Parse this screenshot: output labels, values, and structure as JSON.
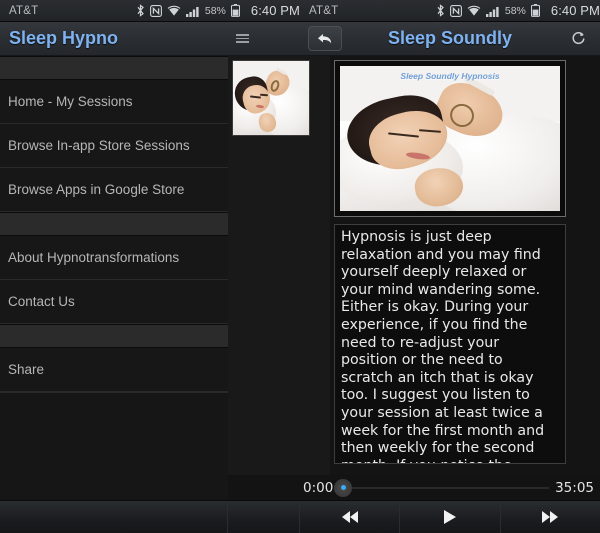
{
  "status_bar_left": {
    "carrier": "AT&T",
    "battery_pct": "58%",
    "clock": "6:40 PM",
    "icons": [
      "bluetooth-icon",
      "nfc-icon",
      "wifi-icon",
      "cell-signal-icon",
      "battery-icon"
    ]
  },
  "status_bar_right": {
    "carrier": "AT&T",
    "battery_pct": "58%",
    "clock": "6:40 PM",
    "icons": [
      "bluetooth-icon",
      "nfc-icon",
      "wifi-icon",
      "cell-signal-icon",
      "battery-icon"
    ]
  },
  "left_app": {
    "title": "Sleep Hypno",
    "menu_icon": "hamburger-menu-icon"
  },
  "right_app": {
    "title": "Sleep Soundly",
    "back_icon": "back-arrow-icon",
    "refresh_icon": "refresh-icon"
  },
  "drawer": {
    "items": [
      {
        "label": "Home - My Sessions"
      },
      {
        "label": "Browse In-app Store Sessions"
      },
      {
        "label": "Browse Apps in Google Store"
      },
      {
        "label": "About Hypnotransformations"
      },
      {
        "label": "Contact Us"
      },
      {
        "label": "Share"
      }
    ]
  },
  "thumbnail": {
    "name": "session-thumbnail",
    "alt": "Woman sleeping on white pillow"
  },
  "content": {
    "hero_caption": "Sleep Soundly Hypnosis",
    "hero_alt": "Woman sleeping peacefully under a white duvet",
    "body": "Hypnosis is just deep relaxation and you may find yourself deeply relaxed or your mind wandering some. Either is okay. During your experience, if you find the need to re-adjust your position or the need to scratch an itch that is okay too. I suggest you listen to your session at least twice a week for the first month and then weekly for the second month. If you notice the suggestions starting to \"wear off\" just start the process over"
  },
  "player": {
    "current_time": "0:00",
    "total_time": "35:05",
    "progress_pct": 0,
    "accent_color": "#3fa9f5",
    "rewind_label": "◀◀",
    "play_label": "▶",
    "forward_label": "▶▶"
  },
  "colors": {
    "title_blue": "#7fb2f0",
    "panel_bg": "#141414",
    "drawer_bg": "#171717",
    "text_primary": "#e9e9e9",
    "text_muted": "#b6b6b6"
  }
}
